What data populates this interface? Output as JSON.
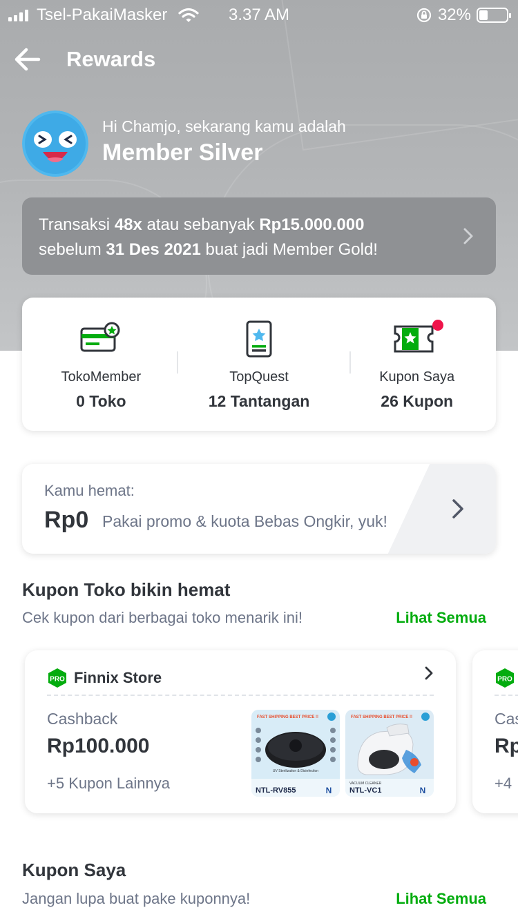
{
  "status": {
    "carrier": "Tsel-PakaiMasker",
    "time": "3.37 AM",
    "battery": "32%",
    "battery_level": 0.32
  },
  "header": {
    "title": "Rewards"
  },
  "member": {
    "greeting": "Hi Chamjo, sekarang kamu adalah",
    "level": "Member Silver"
  },
  "target": {
    "t1": "Transaksi ",
    "count": "48x",
    "t2": " atau sebanyak ",
    "amount": "Rp15.000.000",
    "t3": "sebelum ",
    "date": "31 Des 2021",
    "t4": " buat jadi Member Gold!"
  },
  "stats": [
    {
      "label": "TokoMember",
      "value": "0 Toko",
      "icon": "member-card-icon"
    },
    {
      "label": "TopQuest",
      "value": "12 Tantangan",
      "icon": "quest-scroll-icon"
    },
    {
      "label": "Kupon Saya",
      "value": "26 Kupon",
      "icon": "coupon-ticket-icon"
    }
  ],
  "savings": {
    "label": "Kamu hemat:",
    "amount": "Rp0",
    "desc": "Pakai promo & kuota Bebas Ongkir, yuk!"
  },
  "kupon_toko": {
    "title": "Kupon Toko bikin hemat",
    "subtitle": "Cek kupon dari berbagai toko menarik ini!",
    "see_all": "Lihat Semua"
  },
  "coupons": [
    {
      "store": "Finnix Store",
      "type": "Cashback",
      "amount": "Rp100.000",
      "more": "+5 Kupon Lainnya",
      "badge": "PRO",
      "products": [
        {
          "top": "FAST SHIPPING BEST PRICE !!",
          "caption": "UV Sterilization & Disinfection",
          "model": "NTL-RV855"
        },
        {
          "top": "FAST SHIPPING BEST PRICE !!",
          "caption": "VACUUM CLEANER",
          "model": "NTL-VC1"
        }
      ]
    },
    {
      "store": "",
      "type": "Cas",
      "amount": "Rp",
      "more": "+4",
      "badge": "PRO"
    }
  ],
  "kupon_saya": {
    "title": "Kupon Saya",
    "subtitle": "Jangan lupa buat pake kuponnya!",
    "see_all": "Lihat Semua"
  },
  "colors": {
    "accent": "#03ac0e",
    "hero": "#acaeb0",
    "text": "#31353b",
    "muted": "#6d7588"
  }
}
